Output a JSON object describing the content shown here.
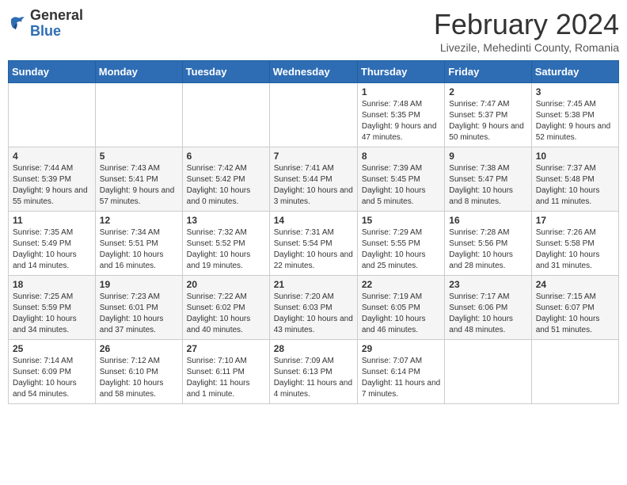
{
  "header": {
    "logo": {
      "line1": "General",
      "line2": "Blue"
    },
    "title": "February 2024",
    "subtitle": "Livezile, Mehedinti County, Romania"
  },
  "weekdays": [
    "Sunday",
    "Monday",
    "Tuesday",
    "Wednesday",
    "Thursday",
    "Friday",
    "Saturday"
  ],
  "weeks": [
    [
      {
        "day": "",
        "info": ""
      },
      {
        "day": "",
        "info": ""
      },
      {
        "day": "",
        "info": ""
      },
      {
        "day": "",
        "info": ""
      },
      {
        "day": "1",
        "info": "Sunrise: 7:48 AM\nSunset: 5:35 PM\nDaylight: 9 hours and 47 minutes."
      },
      {
        "day": "2",
        "info": "Sunrise: 7:47 AM\nSunset: 5:37 PM\nDaylight: 9 hours and 50 minutes."
      },
      {
        "day": "3",
        "info": "Sunrise: 7:45 AM\nSunset: 5:38 PM\nDaylight: 9 hours and 52 minutes."
      }
    ],
    [
      {
        "day": "4",
        "info": "Sunrise: 7:44 AM\nSunset: 5:39 PM\nDaylight: 9 hours and 55 minutes."
      },
      {
        "day": "5",
        "info": "Sunrise: 7:43 AM\nSunset: 5:41 PM\nDaylight: 9 hours and 57 minutes."
      },
      {
        "day": "6",
        "info": "Sunrise: 7:42 AM\nSunset: 5:42 PM\nDaylight: 10 hours and 0 minutes."
      },
      {
        "day": "7",
        "info": "Sunrise: 7:41 AM\nSunset: 5:44 PM\nDaylight: 10 hours and 3 minutes."
      },
      {
        "day": "8",
        "info": "Sunrise: 7:39 AM\nSunset: 5:45 PM\nDaylight: 10 hours and 5 minutes."
      },
      {
        "day": "9",
        "info": "Sunrise: 7:38 AM\nSunset: 5:47 PM\nDaylight: 10 hours and 8 minutes."
      },
      {
        "day": "10",
        "info": "Sunrise: 7:37 AM\nSunset: 5:48 PM\nDaylight: 10 hours and 11 minutes."
      }
    ],
    [
      {
        "day": "11",
        "info": "Sunrise: 7:35 AM\nSunset: 5:49 PM\nDaylight: 10 hours and 14 minutes."
      },
      {
        "day": "12",
        "info": "Sunrise: 7:34 AM\nSunset: 5:51 PM\nDaylight: 10 hours and 16 minutes."
      },
      {
        "day": "13",
        "info": "Sunrise: 7:32 AM\nSunset: 5:52 PM\nDaylight: 10 hours and 19 minutes."
      },
      {
        "day": "14",
        "info": "Sunrise: 7:31 AM\nSunset: 5:54 PM\nDaylight: 10 hours and 22 minutes."
      },
      {
        "day": "15",
        "info": "Sunrise: 7:29 AM\nSunset: 5:55 PM\nDaylight: 10 hours and 25 minutes."
      },
      {
        "day": "16",
        "info": "Sunrise: 7:28 AM\nSunset: 5:56 PM\nDaylight: 10 hours and 28 minutes."
      },
      {
        "day": "17",
        "info": "Sunrise: 7:26 AM\nSunset: 5:58 PM\nDaylight: 10 hours and 31 minutes."
      }
    ],
    [
      {
        "day": "18",
        "info": "Sunrise: 7:25 AM\nSunset: 5:59 PM\nDaylight: 10 hours and 34 minutes."
      },
      {
        "day": "19",
        "info": "Sunrise: 7:23 AM\nSunset: 6:01 PM\nDaylight: 10 hours and 37 minutes."
      },
      {
        "day": "20",
        "info": "Sunrise: 7:22 AM\nSunset: 6:02 PM\nDaylight: 10 hours and 40 minutes."
      },
      {
        "day": "21",
        "info": "Sunrise: 7:20 AM\nSunset: 6:03 PM\nDaylight: 10 hours and 43 minutes."
      },
      {
        "day": "22",
        "info": "Sunrise: 7:19 AM\nSunset: 6:05 PM\nDaylight: 10 hours and 46 minutes."
      },
      {
        "day": "23",
        "info": "Sunrise: 7:17 AM\nSunset: 6:06 PM\nDaylight: 10 hours and 48 minutes."
      },
      {
        "day": "24",
        "info": "Sunrise: 7:15 AM\nSunset: 6:07 PM\nDaylight: 10 hours and 51 minutes."
      }
    ],
    [
      {
        "day": "25",
        "info": "Sunrise: 7:14 AM\nSunset: 6:09 PM\nDaylight: 10 hours and 54 minutes."
      },
      {
        "day": "26",
        "info": "Sunrise: 7:12 AM\nSunset: 6:10 PM\nDaylight: 10 hours and 58 minutes."
      },
      {
        "day": "27",
        "info": "Sunrise: 7:10 AM\nSunset: 6:11 PM\nDaylight: 11 hours and 1 minute."
      },
      {
        "day": "28",
        "info": "Sunrise: 7:09 AM\nSunset: 6:13 PM\nDaylight: 11 hours and 4 minutes."
      },
      {
        "day": "29",
        "info": "Sunrise: 7:07 AM\nSunset: 6:14 PM\nDaylight: 11 hours and 7 minutes."
      },
      {
        "day": "",
        "info": ""
      },
      {
        "day": "",
        "info": ""
      }
    ]
  ]
}
